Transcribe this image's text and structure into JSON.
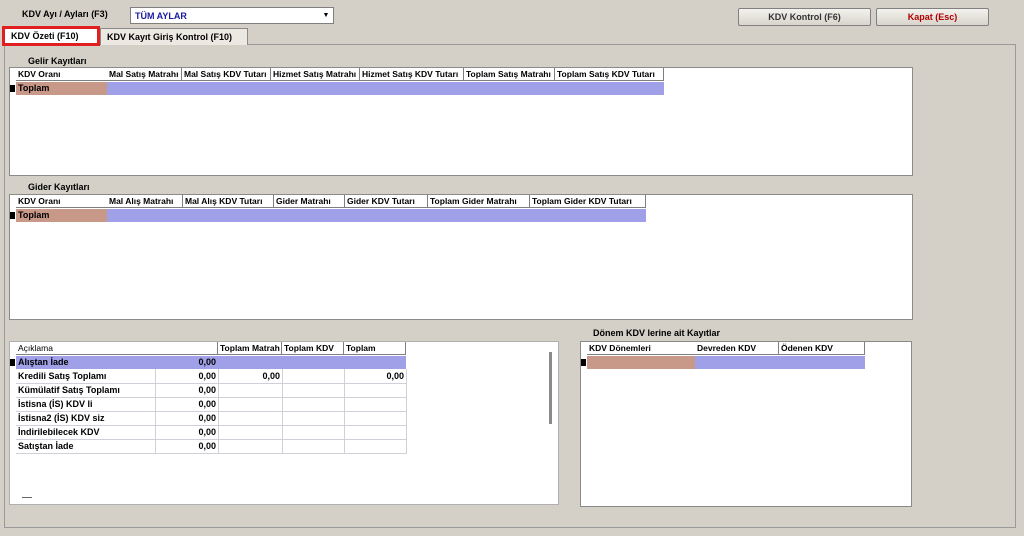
{
  "toolbar": {
    "month_label": "KDV Ayı / Ayları (F3)",
    "month_value": "TÜM AYLAR",
    "kontrol_button": "KDV Kontrol (F6)",
    "kapat_button": "Kapat (Esc)"
  },
  "tabs": [
    {
      "label": "KDV Özeti (F10)"
    },
    {
      "label": "KDV Kayıt Giriş Kontrol  (F10)"
    }
  ],
  "gelir": {
    "title": "Gelir Kayıtları",
    "columns": [
      "KDV Oranı",
      "Mal Satış Matrahı",
      "Mal Satış KDV Tutarı",
      "Hizmet Satış Matrahı",
      "Hizmet Satış KDV Tutarı",
      "Toplam Satış Matrahı",
      "Toplam Satış KDV Tutarı"
    ],
    "total_row": "Toplam"
  },
  "gider": {
    "title": "Gider Kayıtları",
    "columns": [
      "KDV Oranı",
      "Mal Alış Matrahı",
      "Mal Alış KDV Tutarı",
      "Gider Matrahı",
      "Gider KDV Tutarı",
      "Toplam Gider Matrahı",
      "Toplam Gider KDV Tutarı"
    ],
    "total_row": "Toplam"
  },
  "summary": {
    "columns": [
      "Açıklama",
      "",
      "Toplam Matrah",
      "Toplam KDV",
      "Toplam"
    ],
    "rows": [
      {
        "label": "Alıştan İade",
        "v1": "0,00",
        "v2": "",
        "v3": "",
        "v4": ""
      },
      {
        "label": "Kredili Satış Toplamı",
        "v1": "0,00",
        "v2": "0,00",
        "v3": "",
        "v4": "0,00"
      },
      {
        "label": "Kümülatif Satış Toplamı",
        "v1": "0,00",
        "v2": "",
        "v3": "",
        "v4": ""
      },
      {
        "label": "İstisna (İS) KDV li",
        "v1": "0,00",
        "v2": "",
        "v3": "",
        "v4": ""
      },
      {
        "label": "İstisna2 (İS) KDV siz",
        "v1": "0,00",
        "v2": "",
        "v3": "",
        "v4": ""
      },
      {
        "label": "İndirilebilecek KDV",
        "v1": "0,00",
        "v2": "",
        "v3": "",
        "v4": ""
      },
      {
        "label": "Satıştan İade",
        "v1": "0,00",
        "v2": "",
        "v3": "",
        "v4": ""
      }
    ]
  },
  "donem": {
    "title": "Dönem KDV lerine ait Kayıtlar",
    "columns": [
      "KDV Dönemleri",
      "Devreden KDV",
      "Ödenen KDV"
    ]
  }
}
